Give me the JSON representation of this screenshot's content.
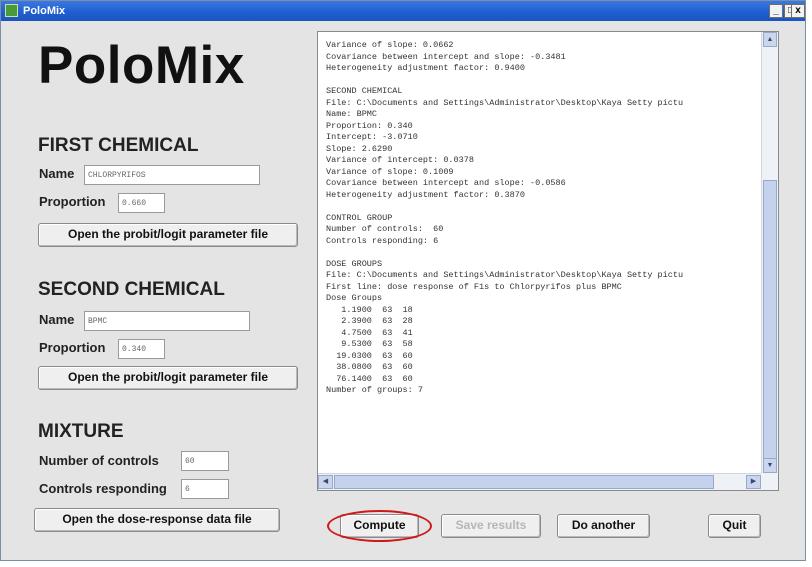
{
  "window": {
    "title": "PoloMix",
    "controls": {
      "minimize": "_",
      "maximize": "□",
      "close": "x"
    }
  },
  "app": {
    "brand": "PoloMix"
  },
  "first_chemical": {
    "heading": "FIRST CHEMICAL",
    "name_label": "Name",
    "name_value": "CHLORPYRIFOS",
    "proportion_label": "Proportion",
    "proportion_value": "0.660",
    "open_button": "Open the probit/logit parameter file"
  },
  "second_chemical": {
    "heading": "SECOND CHEMICAL",
    "name_label": "Name",
    "name_value": "BPMC",
    "proportion_label": "Proportion",
    "proportion_value": "0.340",
    "open_button": "Open the probit/logit parameter file"
  },
  "mixture": {
    "heading": "MIXTURE",
    "controls_label": "Number of controls",
    "controls_value": "60",
    "responding_label": "Controls responding",
    "responding_value": "6",
    "open_button": "Open the dose-response data file"
  },
  "output": {
    "lines": [
      "Variance of slope: 0.0662",
      "Covariance between intercept and slope: -0.3481",
      "Heterogeneity adjustment factor: 0.9400",
      "",
      "SECOND CHEMICAL",
      "File: C:\\Documents and Settings\\Administrator\\Desktop\\Kaya Setty pictu",
      "Name: BPMC",
      "Proportion: 0.340",
      "Intercept: -3.0710",
      "Slope: 2.6290",
      "Variance of intercept: 0.0378",
      "Variance of slope: 0.1009",
      "Covariance between intercept and slope: -0.0586",
      "Heterogeneity adjustment factor: 0.3870",
      "",
      "CONTROL GROUP",
      "Number of controls:  60",
      "Controls responding: 6",
      "",
      "DOSE GROUPS",
      "File: C:\\Documents and Settings\\Administrator\\Desktop\\Kaya Setty pictu",
      "First line: dose response of F1s to Chlorpyrifos plus BPMC",
      "Dose Groups",
      "   1.1900  63  18",
      "   2.3900  63  28",
      "   4.7500  63  41",
      "   9.5300  63  58",
      "  19.0300  63  60",
      "  38.0800  63  60",
      "  76.1400  63  60",
      "Number of groups: 7"
    ]
  },
  "buttons": {
    "compute": "Compute",
    "save": "Save results",
    "another": "Do another",
    "quit": "Quit"
  },
  "colors": {
    "title_bar": "#1f5fd2",
    "window_bg": "#e4e4e4",
    "highlight_circle": "#d01818"
  }
}
